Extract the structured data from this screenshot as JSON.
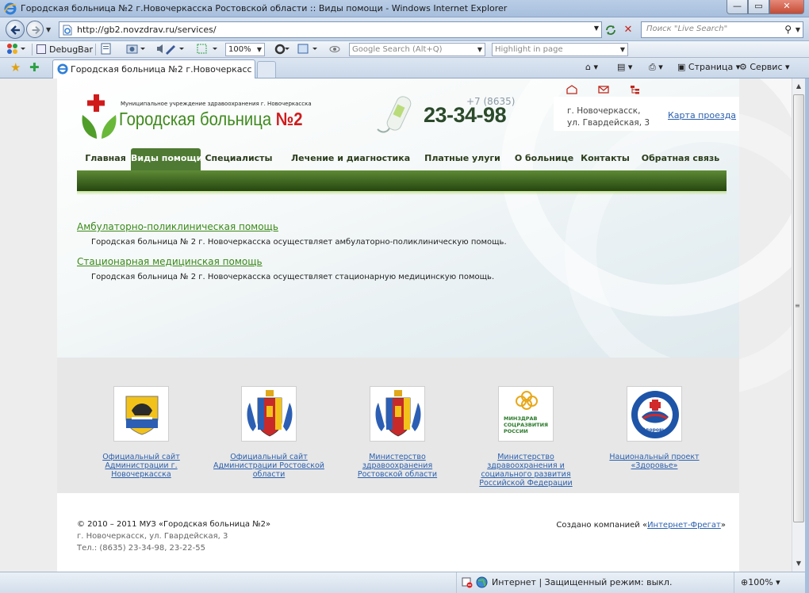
{
  "window": {
    "title": "Городская больница №2 г.Новочеркасска Ростовской области :: Виды помощи - Windows Internet Explorer",
    "minimize": "—",
    "maximize": "▭",
    "close": "✕"
  },
  "nav": {
    "url": "http://gb2.novzdrav.ru/services/",
    "search_placeholder": "Поиск \"Live Search\""
  },
  "toolbar": {
    "debugbar": "DebugBar",
    "zoom": "100%",
    "google_placeholder": "Google Search (Alt+Q)",
    "highlight_placeholder": "Highlight in page"
  },
  "tabs": {
    "active_title": "Городская больница №2 г.Новочеркасска Рост...",
    "page_menu": "Страница",
    "tools_menu": "Сервис"
  },
  "site": {
    "org_small": "Муниципальное учреждение здравоохранения г. Новочеркасска",
    "name_text": "Городская больница ",
    "name_num": "№2",
    "phone_code": "+7 (8635)",
    "phone_number": "23-34-98",
    "address": "г. Новочеркасск, ул. Гвардейская, 3",
    "map_link": "Карта проезда",
    "menu": [
      {
        "label": "Главная"
      },
      {
        "label": "Виды помощи"
      },
      {
        "label": "Специалисты"
      },
      {
        "label": "Лечение и диагностика"
      },
      {
        "label": "Платные улуги"
      },
      {
        "label": "О больнице"
      },
      {
        "label": "Контакты"
      },
      {
        "label": "Обратная связь"
      }
    ],
    "active_menu": "Виды помощи"
  },
  "services": [
    {
      "title": "Амбулаторно-поликлиническая помощь",
      "desc": "Городская больница № 2 г. Новочеркасска осуществляет амбулаторно-поликлиническую помощь."
    },
    {
      "title": "Стационарная медицинская помощь",
      "desc": "Городская больница № 2 г. Новочеркасска осуществляет стационарную медицинскую помощь."
    }
  ],
  "partners": [
    {
      "label": "Официальный сайт Администрации г. Новочеркасска",
      "icon": "novocherkassk-coat-of-arms-icon"
    },
    {
      "label": "Официальный сайт Администрации Ростовской области",
      "icon": "rostov-coat-of-arms-icon"
    },
    {
      "label": "Министерство здравоохранения Ростовской области",
      "icon": "rostov-coat-of-arms-icon"
    },
    {
      "label": "Министерство здравоохранения и социального развития Российской Федерации",
      "icon": "minzdrav-logo-icon",
      "logo_text": "МИНЗДРАВ СОЦРАЗВИТИЯ РОССИИ"
    },
    {
      "label": "Национальный проект «Здоровье»",
      "icon": "national-project-health-icon",
      "logo_text": "«Здоровье»"
    }
  ],
  "footer": {
    "copyright": "© 2010 – 2011 МУЗ «Городская больница №2»",
    "address": "г. Новочеркасск, ул. Гвардейская, 3",
    "tel": "Тел.: (8635) 23-34-98, 23-22-55",
    "created_prefix": "Создано компанией «",
    "created_link": "Интернет-Фрегат",
    "created_suffix": "»"
  },
  "status": {
    "zone": "Интернет | Защищенный режим: выкл.",
    "zoom": "100%"
  },
  "colors": {
    "brand_green": "#3e8a1c",
    "menu_active": "#4f7a33",
    "link_blue": "#2a5fae",
    "cross_red": "#d01b1b"
  }
}
